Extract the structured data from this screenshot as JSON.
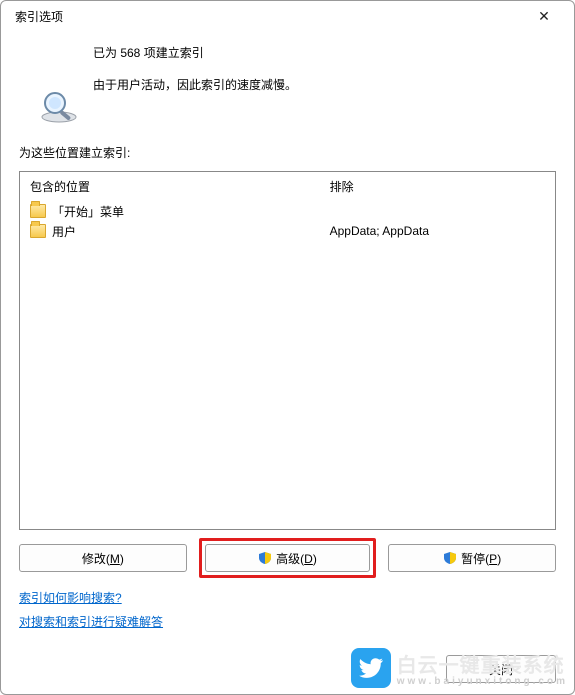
{
  "window": {
    "title": "索引选项",
    "close_label": "✕"
  },
  "status": {
    "line1": "已为 568 项建立索引",
    "line2": "由于用户活动，因此索引的速度减慢。"
  },
  "section_label": "为这些位置建立索引:",
  "columns": {
    "included_header": "包含的位置",
    "excluded_header": "排除"
  },
  "locations": [
    {
      "name": "「开始」菜单",
      "exclude": ""
    },
    {
      "name": "用户",
      "exclude": "AppData; AppData"
    }
  ],
  "buttons": {
    "modify": "修改(M)",
    "advanced": "高级(D)",
    "pause": "暂停(P)",
    "close": "关闭"
  },
  "links": {
    "help1": "索引如何影响搜索?",
    "help2": "对搜索和索引进行疑难解答"
  },
  "watermark": {
    "brand": "白云一键重装系统",
    "url": "www.baiyunxitong.com"
  },
  "icons": {
    "magnifier": "magnifier-icon",
    "shield": "shield-icon",
    "folder": "folder-icon",
    "close": "close-icon",
    "bird": "bird-icon"
  }
}
